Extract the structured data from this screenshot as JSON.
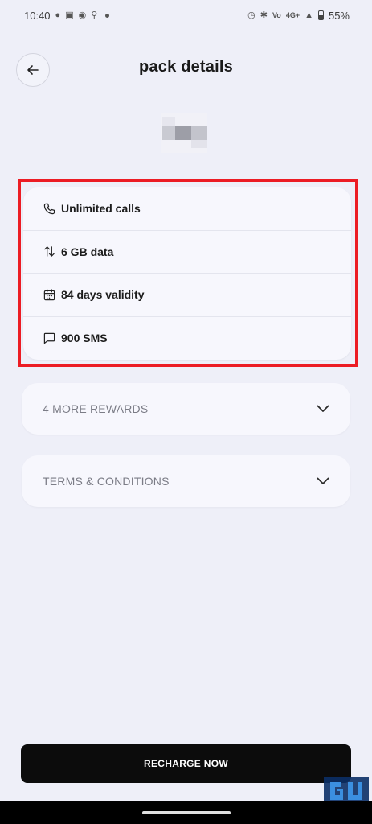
{
  "status_bar": {
    "time": "10:40",
    "network": "4G+",
    "battery": "55%"
  },
  "header": {
    "title": "pack details"
  },
  "benefits": [
    {
      "icon": "phone-icon",
      "label": "Unlimited calls"
    },
    {
      "icon": "data-transfer-icon",
      "label": "6 GB data"
    },
    {
      "icon": "calendar-icon",
      "label": "84 days validity"
    },
    {
      "icon": "message-icon",
      "label": "900 SMS"
    }
  ],
  "sections": {
    "rewards_label": "4 MORE REWARDS",
    "terms_label": "TERMS & CONDITIONS"
  },
  "footer": {
    "cta_label": "RECHARGE NOW"
  },
  "colors": {
    "background": "#eeeff8",
    "card": "#f7f7fd",
    "highlight": "#ec1c24",
    "button": "#0c0c0c"
  }
}
